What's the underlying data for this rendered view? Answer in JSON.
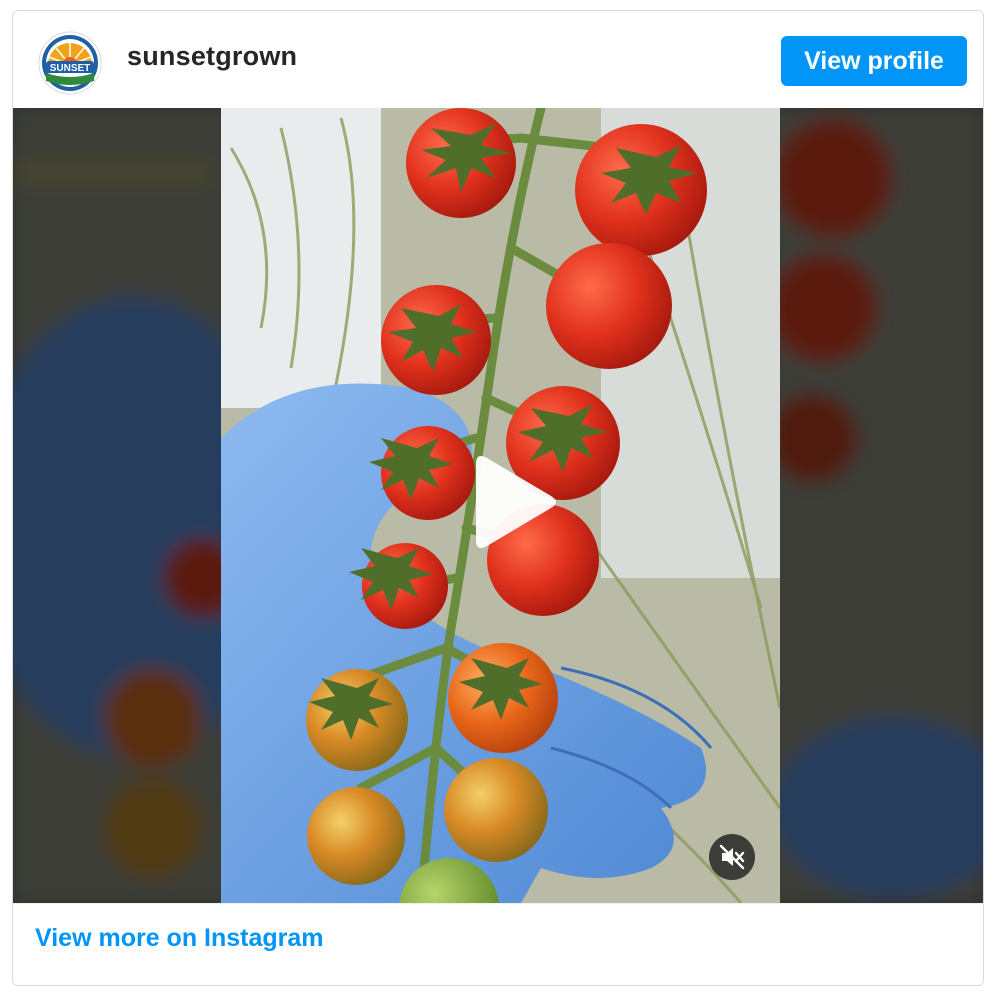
{
  "header": {
    "username": "sunsetgrown",
    "avatar_text": "SUNSET",
    "view_profile_label": "View profile"
  },
  "media": {
    "type": "video",
    "play_icon": "play-icon",
    "mute_icon": "muted-speaker-icon"
  },
  "footer": {
    "view_more_label": "View more on Instagram"
  },
  "colors": {
    "accent": "#0095f6",
    "tomato": "#e0311d",
    "glove": "#6fa4e6",
    "vine": "#6b8c3e"
  }
}
